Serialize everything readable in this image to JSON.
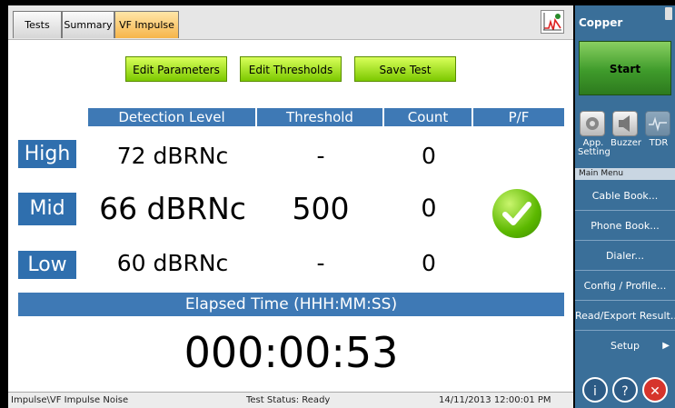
{
  "tabs": [
    {
      "label": "Tests",
      "active": false
    },
    {
      "label": "Summary",
      "active": false
    },
    {
      "label": "VF Impulse",
      "active": true
    }
  ],
  "actions": {
    "edit_parameters": "Edit Parameters",
    "edit_thresholds": "Edit Thresholds",
    "save_test": "Save Test"
  },
  "table": {
    "headers": [
      "Detection Level",
      "Threshold",
      "Count",
      "P/F"
    ],
    "rows": [
      {
        "label": "High",
        "detection": "72 dBRNc",
        "threshold": "-",
        "count": "0",
        "pf": ""
      },
      {
        "label": "Mid",
        "detection": "66 dBRNc",
        "threshold": "500",
        "count": "0",
        "pf": "pass-check-icon"
      },
      {
        "label": "Low",
        "detection": "60 dBRNc",
        "threshold": "-",
        "count": "0",
        "pf": ""
      }
    ]
  },
  "elapsed": {
    "label": "Elapsed Time (HHH:MM:SS)",
    "value": "000:00:53"
  },
  "status": {
    "path": "Impulse\\VF Impulse Noise",
    "test_status": "Test Status: Ready",
    "datetime": "14/11/2013 12:00:01 PM"
  },
  "side": {
    "title": "Copper",
    "start_label": "Start",
    "tools": [
      {
        "label": "App. Setting",
        "icon": "wrench-icon"
      },
      {
        "label": "Buzzer",
        "icon": "speaker-icon"
      },
      {
        "label": "TDR",
        "icon": "waveform-icon"
      }
    ],
    "menu_header": "Main Menu",
    "menu": [
      "Cable Book...",
      "Phone Book...",
      "Dialer...",
      "Config / Profile...",
      "Read/Export Result...",
      "Setup"
    ],
    "bottom_buttons": [
      "info-icon",
      "help-icon",
      "close-icon"
    ]
  },
  "colors": {
    "header_blue": "#3e79b5",
    "label_blue": "#2f6fae",
    "action_green": "#7cc900",
    "start_green": "#3f9b2b",
    "active_tab": "#f6b54a",
    "side_panel": "#3a6f99"
  }
}
